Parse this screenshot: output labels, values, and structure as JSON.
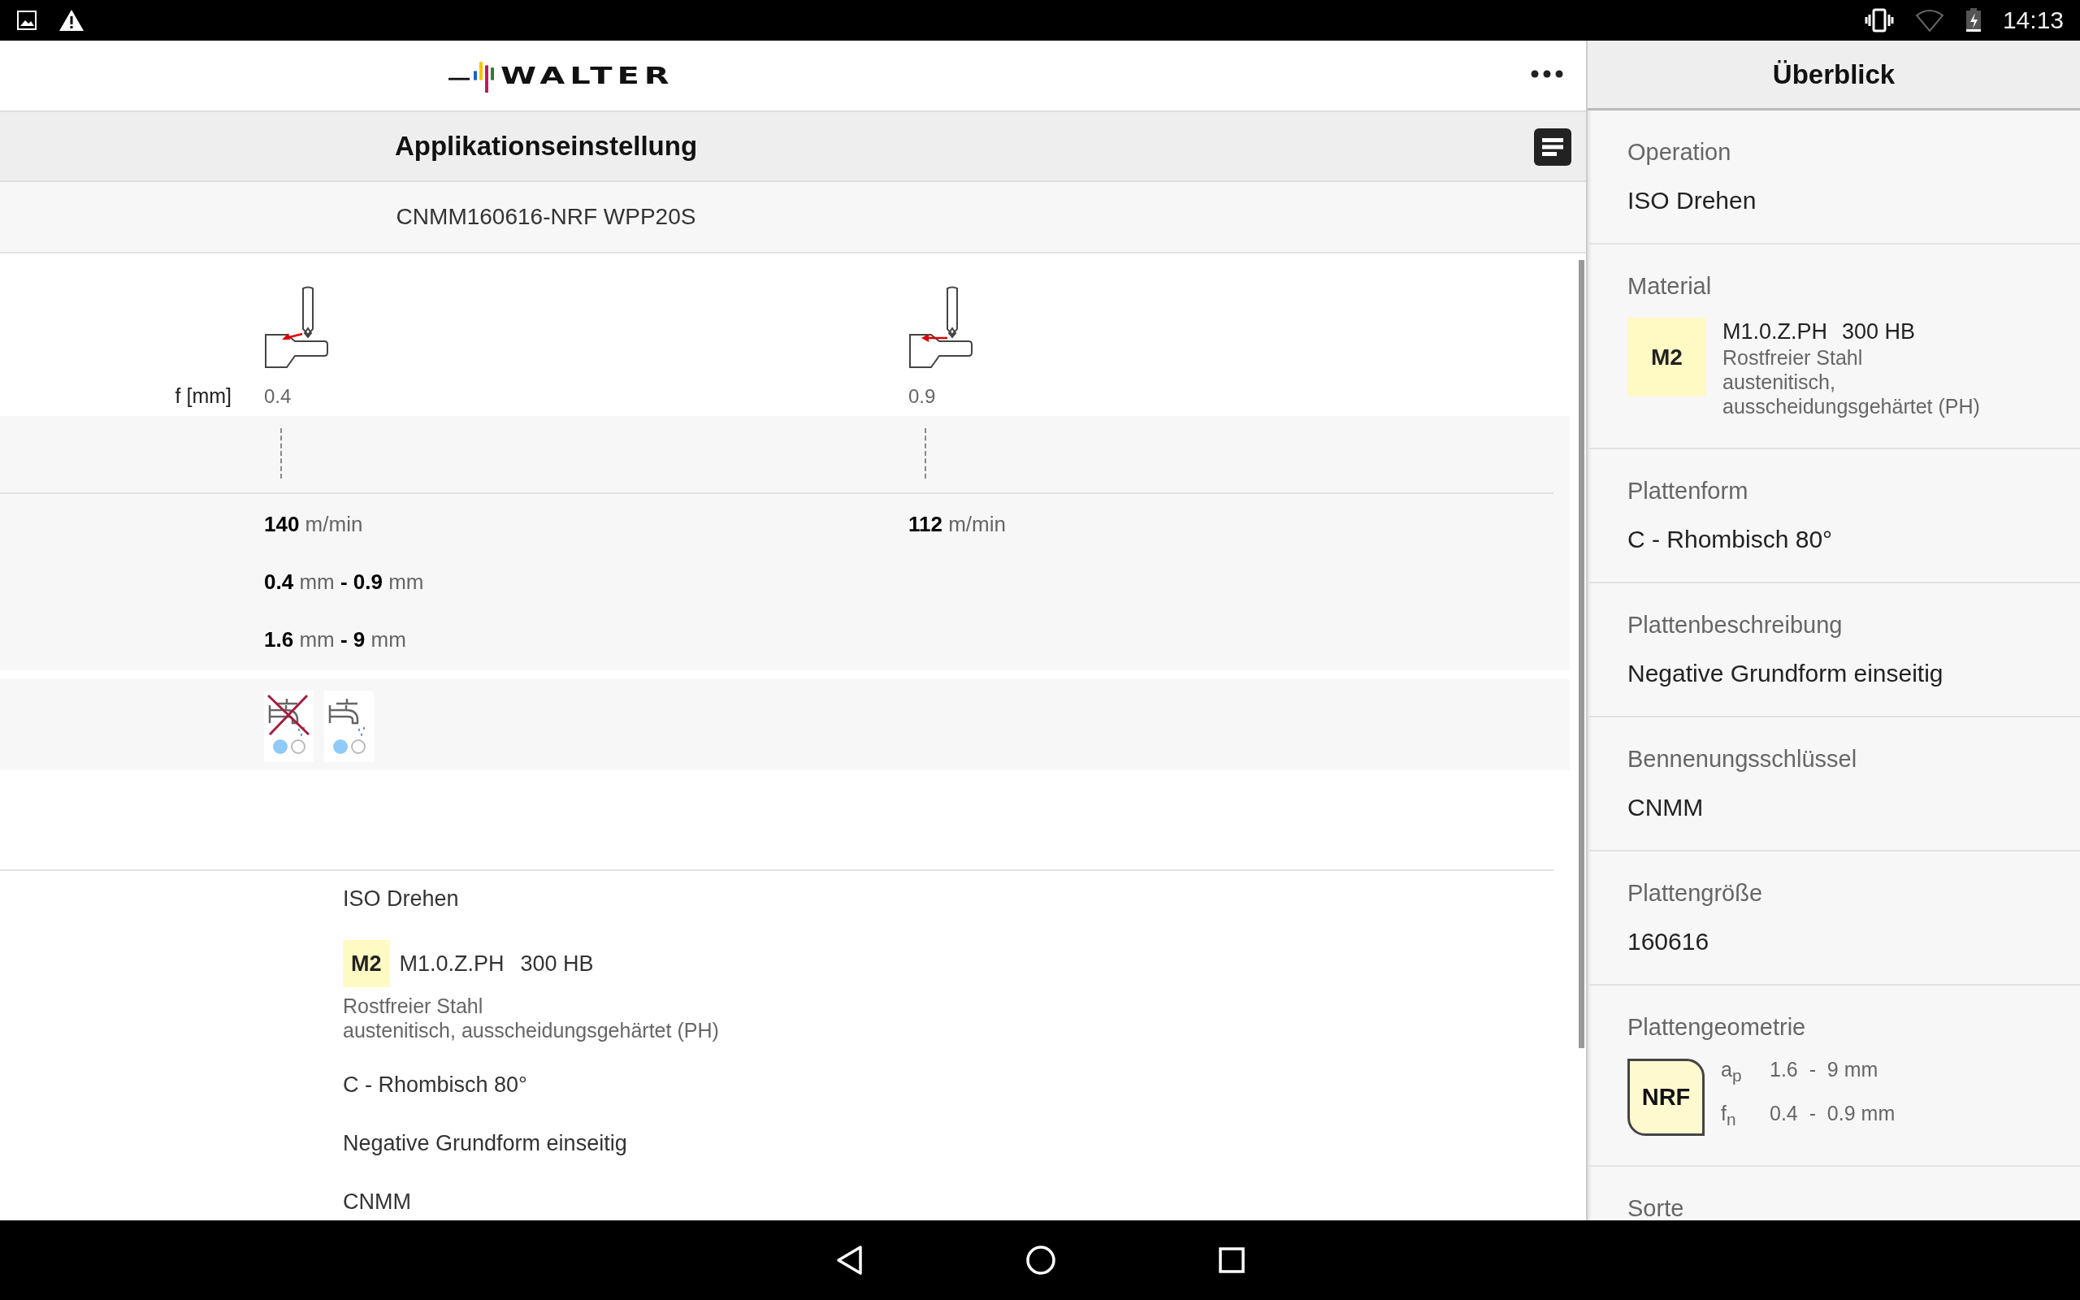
{
  "status_bar": {
    "time": "14:13"
  },
  "header": {
    "logo": "WALTER",
    "title": "Applikationseinstellung",
    "product_code": "CNMM160616-NRF WPP20S"
  },
  "cutting_data": {
    "feed_label": "f [mm]",
    "columns": [
      {
        "feed": "0.4",
        "kind": "diagonal",
        "speed": "**140** m/min"
      },
      {
        "feed": "0.9",
        "kind": "horizontal",
        "speed": "**112** m/min"
      }
    ],
    "ranges": [
      "**0.4** mm **- 0.9** mm",
      "**1.6** mm **- 9** mm"
    ]
  },
  "coolant": [
    {
      "kind": "dry",
      "dots": [
        {
          "filled": true
        },
        {
          "filled": false
        }
      ]
    },
    {
      "kind": "wet",
      "dots": [
        {
          "filled": true
        },
        {
          "filled": false
        }
      ]
    }
  ],
  "summary": {
    "operation": "ISO Drehen",
    "material": {
      "group": "M2",
      "code": "M1.0.Z.PH",
      "hardness": "300 HB",
      "description": [
        "Rostfreier Stahl",
        "austenitisch, ausscheidungsgehärtet (PH)"
      ]
    },
    "lines": [
      "C - Rhombisch 80°",
      "Negative Grundform einseitig",
      "CNMM"
    ]
  },
  "overview": {
    "title": "Überblick",
    "sections": [
      {
        "kind": "text",
        "label": "Operation",
        "value": "ISO Drehen"
      },
      {
        "kind": "material",
        "label": "Material",
        "group": "M2",
        "code": "M1.0.Z.PH",
        "hardness": "300 HB",
        "description": [
          "Rostfreier Stahl",
          "austenitisch,",
          "ausscheidungsgehärtet (PH)"
        ]
      },
      {
        "kind": "text",
        "label": "Plattenform",
        "value": "C - Rhombisch 80°"
      },
      {
        "kind": "text",
        "label": "Plattenbeschreibung",
        "value": "Negative Grundform einseitig"
      },
      {
        "kind": "text",
        "label": "Bennenungsschlüssel",
        "value": "CNMM"
      },
      {
        "kind": "text",
        "label": "Plattengröße",
        "value": "160616"
      },
      {
        "kind": "geometry",
        "label": "Plattengeometrie",
        "badge": "NRF",
        "ranges": [
          {
            "symbol": "a$_{p}$",
            "range": "1.6  -  9 mm"
          },
          {
            "symbol": "f$_{n}$",
            "range": "0.4  -  0.9 mm"
          }
        ]
      },
      {
        "kind": "label",
        "label": "Sorte"
      }
    ]
  }
}
